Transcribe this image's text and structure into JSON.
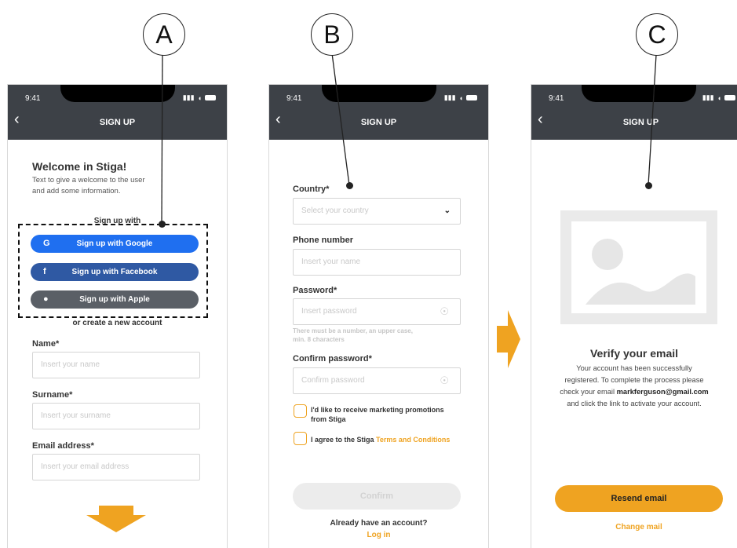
{
  "markers": [
    "A",
    "B",
    "C"
  ],
  "status": {
    "time": "9:41",
    "signal": "❙❙❙"
  },
  "screen_a": {
    "nav_title": "SIGN UP",
    "welcome_title": "Welcome in Stiga!",
    "welcome_text_1": "Text to give a welcome to the user",
    "welcome_text_2": "and add some information.",
    "sign_up_with": "Sign up with",
    "google_label": "Sign up with Google",
    "facebook_label": "Sign up with Facebook",
    "apple_label": "Sign up with Apple",
    "or_create": "or create a new account",
    "name_label": "Name*",
    "name_placeholder": "Insert your name",
    "surname_label": "Surname*",
    "surname_placeholder": "Insert your surname",
    "email_label": "Email address*",
    "email_placeholder": "Insert your email address"
  },
  "screen_b": {
    "nav_title": "SIGN UP",
    "country_label": "Country*",
    "country_placeholder": "Select your country",
    "phone_label": "Phone number",
    "phone_placeholder": "Insert your name",
    "password_label": "Password*",
    "password_placeholder": "Insert password",
    "password_hint_1": "There must be a number, an upper case,",
    "password_hint_2": "min. 8 characters",
    "confirm_label": "Confirm password*",
    "confirm_placeholder": "Confirm password",
    "marketing_1": "I'd like to receive marketing promotions",
    "marketing_2": "from Stiga",
    "agree_prefix": "I agree to the Stiga ",
    "agree_link": "Terms and Conditions",
    "confirm_button": "Confirm",
    "have_account": "Already have an account?",
    "login_link": "Log in"
  },
  "screen_c": {
    "nav_title": "SIGN UP",
    "verify_title": "Verify your email",
    "verify_line_1": "Your account has been successfully",
    "verify_line_2": "registered. To complete the process please",
    "verify_line_3_prefix": "check your email ",
    "verify_email": "markferguson@gmail.com",
    "verify_line_4": "and click the link to activate your account.",
    "resend_button": "Resend email",
    "change_mail": "Change mail"
  },
  "colors": {
    "accent": "#efa321",
    "google": "#1f6ff0",
    "facebook": "#2f59a3",
    "apple": "#5a5f66",
    "header": "#3d4147"
  }
}
